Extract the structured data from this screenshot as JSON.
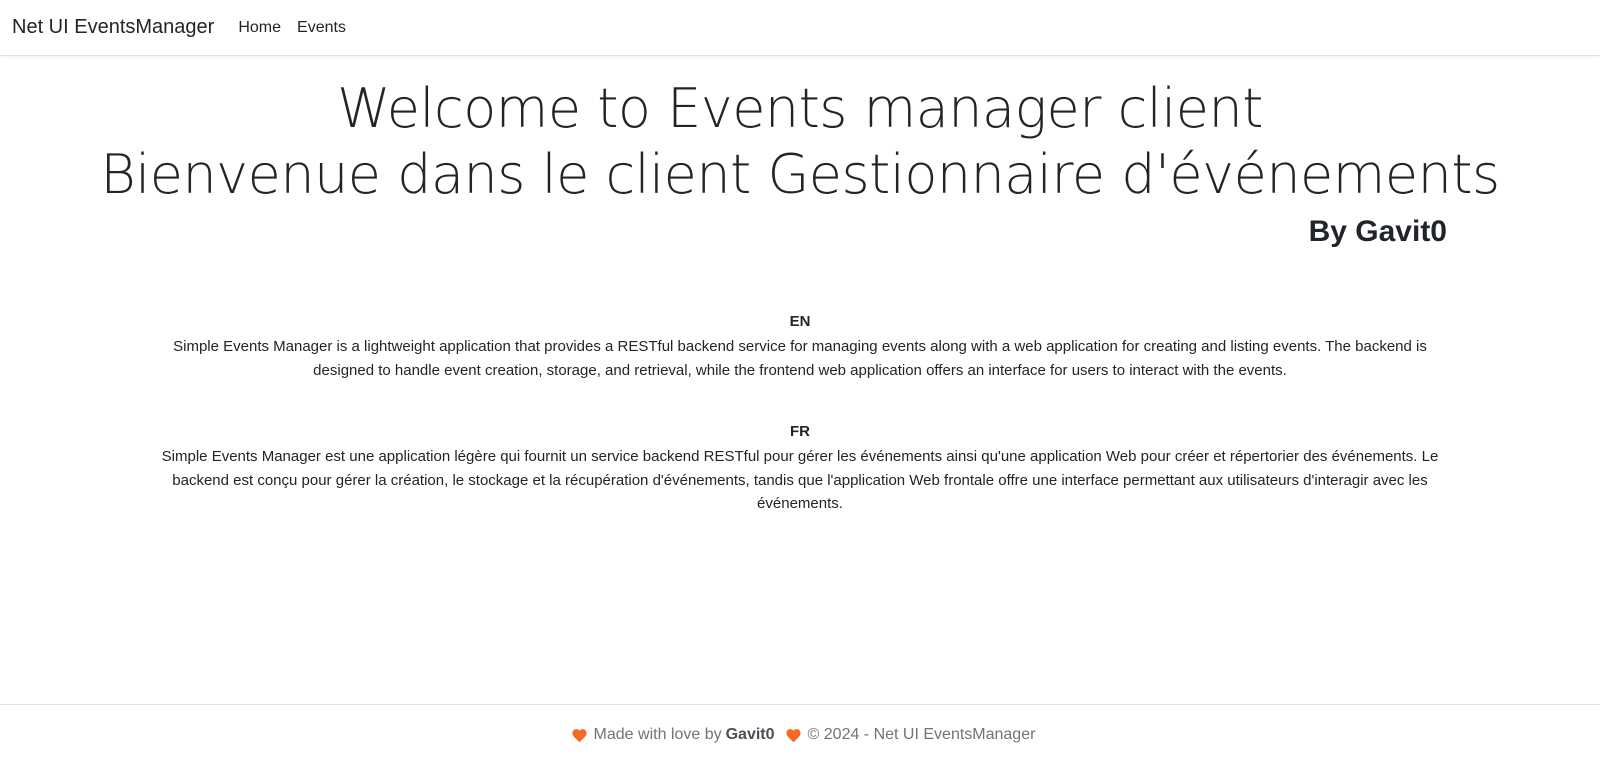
{
  "navbar": {
    "brand": "Net UI EventsManager",
    "links": [
      "Home",
      "Events"
    ]
  },
  "hero": {
    "title_en": "Welcome to Events manager client",
    "title_fr": "Bienvenue dans le client Gestionnaire d'événements",
    "author": "By Gavit0"
  },
  "sections": {
    "en": {
      "label": "EN",
      "text": "Simple Events Manager is a lightweight application that provides a RESTful backend service for managing events along with a web application for creating and listing events. The backend is designed to handle event creation, storage, and retrieval, while the frontend web application offers an interface for users to interact with the events."
    },
    "fr": {
      "label": "FR",
      "text": "Simple Events Manager est une application légère qui fournit un service backend RESTful pour gérer les événements ainsi qu'une application Web pour créer et répertorier des événements. Le backend est conçu pour gérer la création, le stockage et la récupération d'événements, tandis que l'application Web frontale offre une interface permettant aux utilisateurs d'interagir avec les événements."
    }
  },
  "footer": {
    "made_with": "Made with love by",
    "author": "Gavit0",
    "copyright": "© 2024 - Net UI EventsManager",
    "heart_icon": "heart-icon",
    "heart_color": "#f46a24"
  },
  "colors": {
    "text": "#212529",
    "muted": "#6c757d",
    "border": "#dee2e6"
  }
}
